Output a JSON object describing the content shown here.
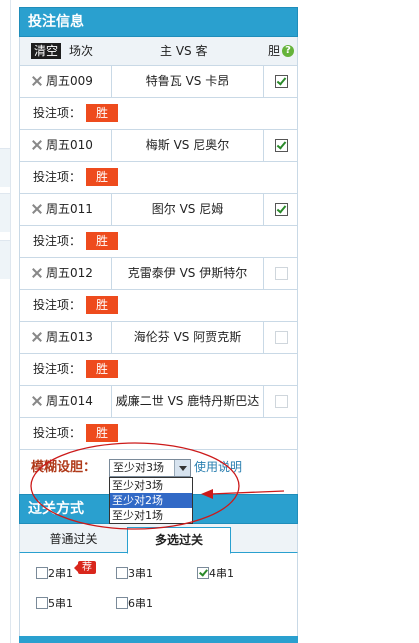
{
  "panel": {
    "title": "投注信息",
    "clear_label": "清空",
    "col_no": "场次",
    "col_match": "主 VS 客",
    "col_dan": "胆",
    "help_icon": "?",
    "bet_label": "投注项：",
    "matches": [
      {
        "no": "周五009",
        "teams": "特鲁瓦 VS 卡昂",
        "bet": "胜",
        "dan": true
      },
      {
        "no": "周五010",
        "teams": "梅斯 VS 尼奥尔",
        "bet": "胜",
        "dan": true
      },
      {
        "no": "周五011",
        "teams": "图尔 VS 尼姆",
        "bet": "胜",
        "dan": true
      },
      {
        "no": "周五012",
        "teams": "克雷泰伊 VS 伊斯特尔",
        "bet": "胜",
        "dan": false
      },
      {
        "no": "周五013",
        "teams": "海伦芬 VS 阿贾克斯",
        "bet": "胜",
        "dan": false
      },
      {
        "no": "周五014",
        "teams": "威廉二世 VS 鹿特丹斯巴达",
        "bet": "胜",
        "dan": false
      }
    ]
  },
  "fuzzy": {
    "label": "模糊设胆：",
    "selected": "至少对3场",
    "usage_link": "使用说明",
    "options": [
      "至少对3场",
      "至少对2场",
      "至少对1场"
    ],
    "highlighted_index": 1
  },
  "pass": {
    "title": "过关方式",
    "tabs": [
      "普通过关",
      "多选过关"
    ],
    "active_tab": 1,
    "recommend_badge": "荐",
    "options": [
      {
        "label": "2串1",
        "checked": false
      },
      {
        "label": "3串1",
        "checked": false
      },
      {
        "label": "4串1",
        "checked": true
      },
      {
        "label": "5串1",
        "checked": false
      },
      {
        "label": "6串1",
        "checked": false
      }
    ]
  },
  "colors": {
    "header": "#2aa0cf",
    "bet_chip": "#ee4b1d",
    "fuzzy_label": "#b03a1a",
    "annotation": "#cc1a1a",
    "dropdown_highlight": "#3169c6"
  }
}
